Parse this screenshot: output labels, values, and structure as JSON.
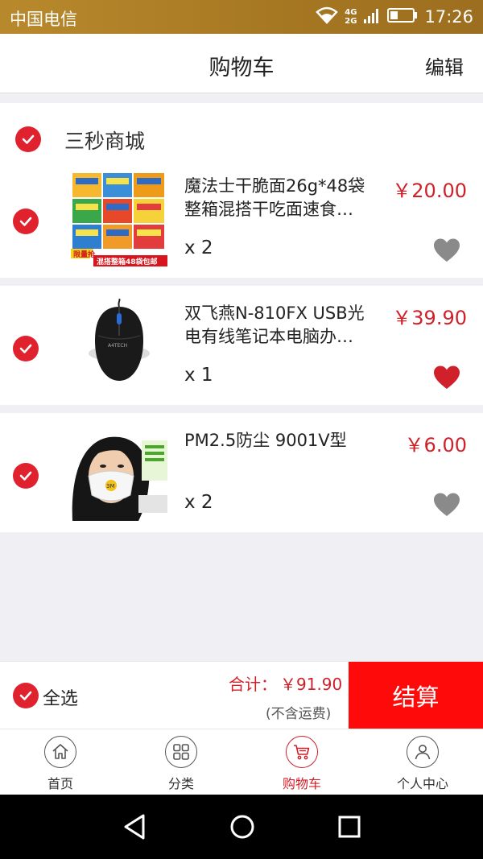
{
  "status_bar": {
    "carrier": "中国电信",
    "network_top": "4G",
    "network_bottom": "2G",
    "time": "17:26"
  },
  "header": {
    "title": "购物车",
    "edit_label": "编辑"
  },
  "shop": {
    "name": "三秒商城",
    "checked": true
  },
  "items": [
    {
      "name": "魔法士干脆面26g*48袋整箱混搭干吃面速食…",
      "price": "￥20.00",
      "quantity": "x 2",
      "checked": true,
      "favorited": false,
      "image_label": "product-noodles-image",
      "banner_top": "限量抢",
      "banner_bottom": "混搭整箱48袋包邮"
    },
    {
      "name": "双飞燕N-810FX USB光电有线笔记本电脑办…",
      "price": "￥39.90",
      "quantity": "x 1",
      "checked": true,
      "favorited": true,
      "image_label": "product-mouse-image",
      "mouse_brand": "A4TECH"
    },
    {
      "name": "PM2.5防尘 9001V型",
      "price": "￥6.00",
      "quantity": "x 2",
      "checked": true,
      "favorited": false,
      "image_label": "product-mask-image",
      "mask_brand": "3M"
    }
  ],
  "footer": {
    "select_all_label": "全选",
    "total_label": "合计：",
    "total_value": "￥91.90",
    "shipping_note": "(不含运费)",
    "checkout_label": "结算"
  },
  "tabs": [
    {
      "label": "首页",
      "icon": "home-icon",
      "active": false
    },
    {
      "label": "分类",
      "icon": "grid-icon",
      "active": false
    },
    {
      "label": "购物车",
      "icon": "cart-icon",
      "active": true
    },
    {
      "label": "个人中心",
      "icon": "user-icon",
      "active": false
    }
  ],
  "colors": {
    "accent": "#d0202a",
    "checkout": "#ff0a0a",
    "status_bar": "#a67722",
    "fav_active": "#d0202a",
    "fav_inactive": "#8a8a8a"
  }
}
